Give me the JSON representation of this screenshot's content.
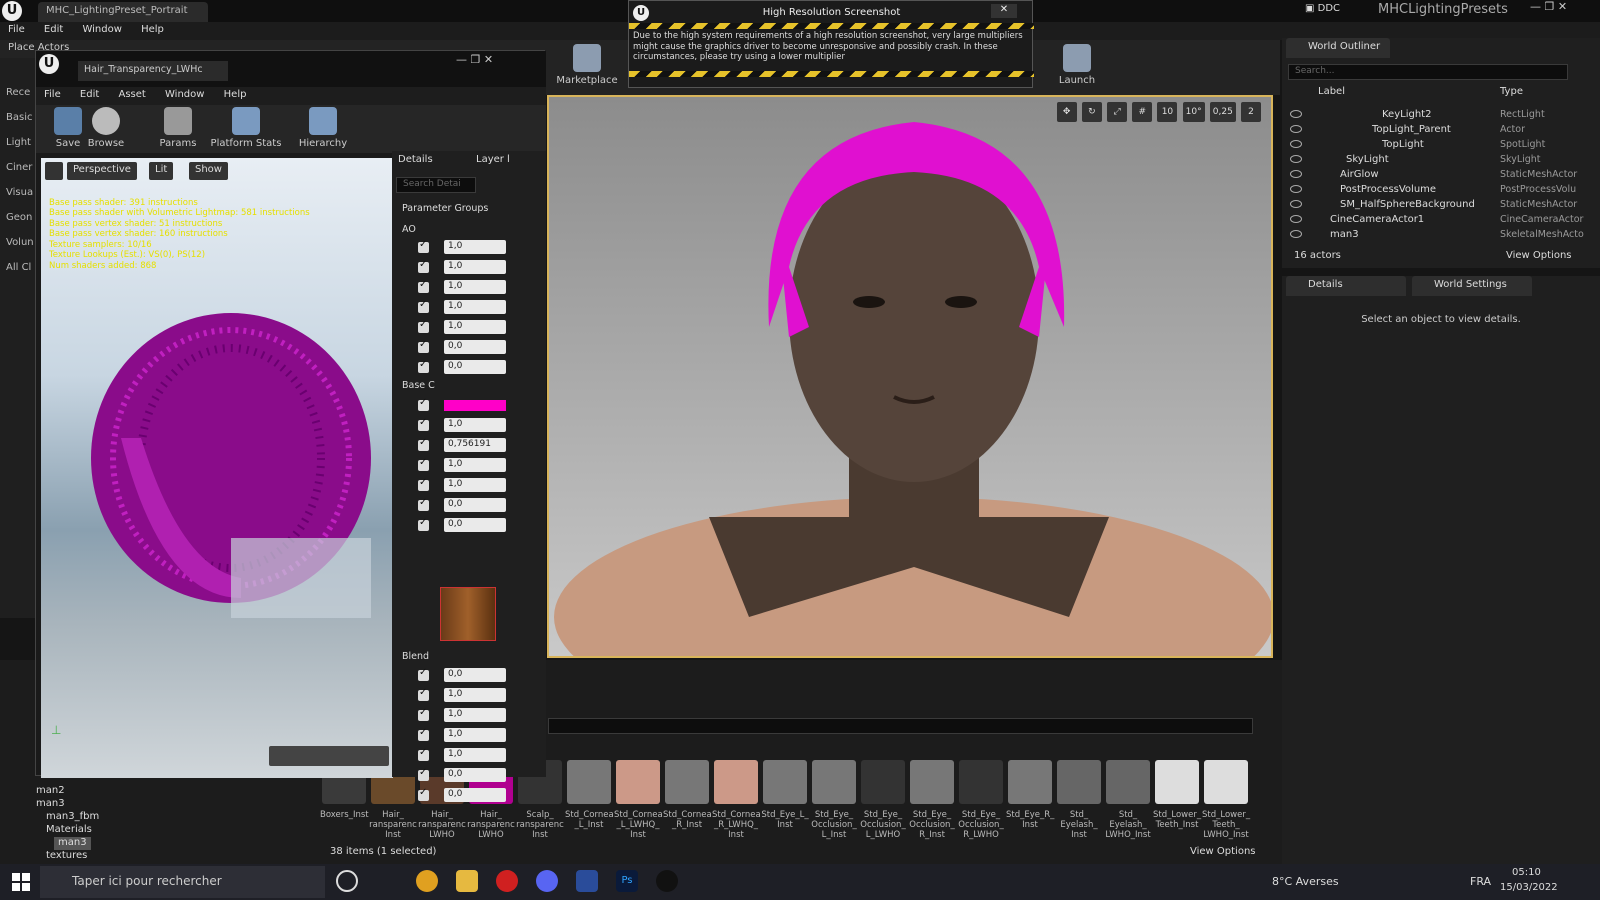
{
  "editor": {
    "tab_title": "MHC_LightingPreset_Portrait",
    "right_project": "MHCLightingPresets",
    "ddc_label": "DDC",
    "menu": [
      "File",
      "Edit",
      "Window",
      "Help"
    ],
    "place_actors": "Place Actors",
    "modes": [
      "Rece",
      "Basic",
      "Light",
      "Ciner",
      "Visua",
      "Geon",
      "Volun",
      "All Cl"
    ],
    "toolbar": {
      "marketplace": "Marketplace",
      "launch": "Launch"
    }
  },
  "notification": {
    "title": "High Resolution Screenshot",
    "message": "Due to the high system requirements of a high resolution screenshot, very large multipliers might cause the graphics driver to become unresponsive and possibly crash. In these circumstances, please try using a lower multiplier"
  },
  "viewport_tools": {
    "grid": "10",
    "rotation": "10°",
    "scale": "0,25",
    "camera_speed": "2"
  },
  "material_editor": {
    "tab": "Hair_Transparency_LWHc",
    "menu": [
      "File",
      "Edit",
      "Asset",
      "Window",
      "Help"
    ],
    "toolbar": [
      "Save",
      "Browse",
      "Params",
      "Platform Stats",
      "Hierarchy"
    ],
    "viewport_buttons": {
      "perspective": "Perspective",
      "lit": "Lit",
      "show": "Show"
    },
    "stats": [
      "Base pass shader: 391 instructions",
      "Base pass shader with Volumetric Lightmap: 581 instructions",
      "Base pass vertex shader: 51 instructions",
      "Base pass vertex shader: 160 instructions",
      "Texture samplers: 10/16",
      "Texture Lookups (Est.): VS(0), PS(12)",
      "Num shaders added: 868"
    ],
    "panel_tabs": [
      "Details",
      "Layer l"
    ],
    "search_placeholder": "Search Detai",
    "groups_header": "Parameter Groups",
    "ao_label": "AO",
    "ao_values": [
      "1,0",
      "1,0",
      "1,0",
      "1,0",
      "1,0",
      "0,0",
      "0,0"
    ],
    "base_label": "Base C",
    "base_values": [
      "1,0",
      "0,756191",
      "1,0",
      "1,0",
      "0,0",
      "0,0"
    ],
    "blend_label": "Blend",
    "blend_values": [
      "0,0",
      "1,0",
      "1,0",
      "1,0",
      "1,0",
      "0,0",
      "0,0"
    ],
    "base_color": "#ff00c8"
  },
  "outliner": {
    "tab": "World Outliner",
    "search_placeholder": "Search...",
    "col_label": "Label",
    "col_type": "Type",
    "rows": [
      {
        "label": "KeyLight2",
        "type": "RectLight"
      },
      {
        "label": "TopLight_Parent",
        "type": "Actor"
      },
      {
        "label": "TopLight",
        "type": "SpotLight"
      },
      {
        "label": "SkyLight",
        "type": "SkyLight"
      },
      {
        "label": "AirGlow",
        "type": "StaticMeshActor"
      },
      {
        "label": "PostProcessVolume",
        "type": "PostProcessVolu"
      },
      {
        "label": "SM_HalfSphereBackground",
        "type": "StaticMeshActor"
      },
      {
        "label": "CineCameraActor1",
        "type": "CineCameraActor"
      },
      {
        "label": "man3",
        "type": "SkeletalMeshActo"
      }
    ],
    "count": "16 actors",
    "view_options": "View Options"
  },
  "details": {
    "tab_details": "Details",
    "tab_world": "World Settings",
    "empty": "Select an object to view details."
  },
  "content_browser": {
    "status": "38 items (1 selected)",
    "view_options": "View Options",
    "assets": [
      {
        "label": "Boxers_Inst",
        "color": "#3a3a3a"
      },
      {
        "label": "Hair_ ransparenc Inst",
        "color": "#6a4a2a"
      },
      {
        "label": "Hair_ ransparenc LWHO",
        "color": "#5a3a2a"
      },
      {
        "label": "Hair_ ransparenc LWHO",
        "color": "#b00090"
      },
      {
        "label": "Scalp_ ransparenc Inst",
        "color": "#333"
      },
      {
        "label": "Std_Cornea _L_Inst",
        "color": "#777"
      },
      {
        "label": "Std_Cornea _L_LWHQ_ Inst",
        "color": "#c98"
      },
      {
        "label": "Std_Cornea _R_Inst",
        "color": "#777"
      },
      {
        "label": "Std_Cornea _R_LWHQ_ Inst",
        "color": "#c98"
      },
      {
        "label": "Std_Eye_L_ Inst",
        "color": "#777"
      },
      {
        "label": "Std_Eye_ Occlusion_ L_Inst",
        "color": "#777"
      },
      {
        "label": "Std_Eye_ Occlusion_ L_LWHO",
        "color": "#333"
      },
      {
        "label": "Std_Eye_ Occlusion_ R_Inst",
        "color": "#777"
      },
      {
        "label": "Std_Eye_ Occlusion_ R_LWHO",
        "color": "#333"
      },
      {
        "label": "Std_Eye_R_ Inst",
        "color": "#777"
      },
      {
        "label": "Std_ Eyelash_ Inst",
        "color": "#666"
      },
      {
        "label": "Std_ Eyelash_ LWHO_Inst",
        "color": "#666"
      },
      {
        "label": "Std_Lower_ Teeth_Inst",
        "color": "#ddd"
      },
      {
        "label": "Std_Lower_ Teeth_ LWHO_Inst",
        "color": "#ddd"
      }
    ],
    "tree": [
      "man2",
      "man3",
      "man3_fbm",
      "Materials",
      "man3",
      "textures"
    ]
  },
  "taskbar": {
    "search_placeholder": "Taper ici pour rechercher",
    "weather": "8°C  Averses",
    "lang": "FRA",
    "time": "05:10",
    "date": "15/03/2022"
  }
}
